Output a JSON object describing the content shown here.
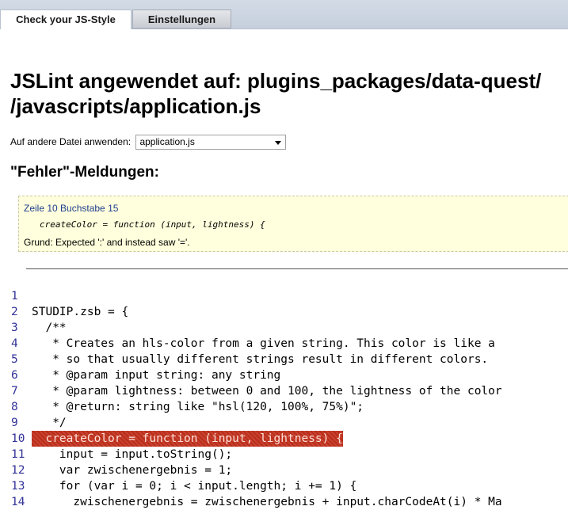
{
  "tabs": [
    {
      "label": "Check your JS-Style",
      "active": true
    },
    {
      "label": "Einstellungen",
      "active": false
    }
  ],
  "page_title": "JSLint angewendet auf: plugins_packages/data-quest/",
  "page_title_line2": "/javascripts/application.js",
  "file_select": {
    "label": "Auf andere Datei anwenden:",
    "value": "application.js"
  },
  "errors_heading": "\"Fehler\"-Meldungen:",
  "error": {
    "position": "Zeile 10 Buchstabe 15",
    "code": "createColor = function (input, lightness) {",
    "reason": "Grund: Expected ':' and instead saw '='."
  },
  "code_lines": [
    {
      "num": "1",
      "text": ""
    },
    {
      "num": "2",
      "text": "STUDIP.zsb = {"
    },
    {
      "num": "3",
      "text": "  /**"
    },
    {
      "num": "4",
      "text": "   * Creates an hls-color from a given string. This color is like a"
    },
    {
      "num": "5",
      "text": "   * so that usually different strings result in different colors."
    },
    {
      "num": "6",
      "text": "   * @param input string: any string"
    },
    {
      "num": "7",
      "text": "   * @param lightness: between 0 and 100, the lightness of the color"
    },
    {
      "num": "8",
      "text": "   * @return: string like \"hsl(120, 100%, 75%)\";"
    },
    {
      "num": "9",
      "text": "   */"
    },
    {
      "num": "10",
      "text": "  createColor = function (input, lightness) {",
      "highlight": true
    },
    {
      "num": "11",
      "text": "    input = input.toString();"
    },
    {
      "num": "12",
      "text": "    var zwischenergebnis = 1;"
    },
    {
      "num": "13",
      "text": "    for (var i = 0; i < input.length; i += 1) {"
    },
    {
      "num": "14",
      "text": "      zwischenergebnis = zwischenergebnis + input.charCodeAt(i) * Ma"
    }
  ]
}
